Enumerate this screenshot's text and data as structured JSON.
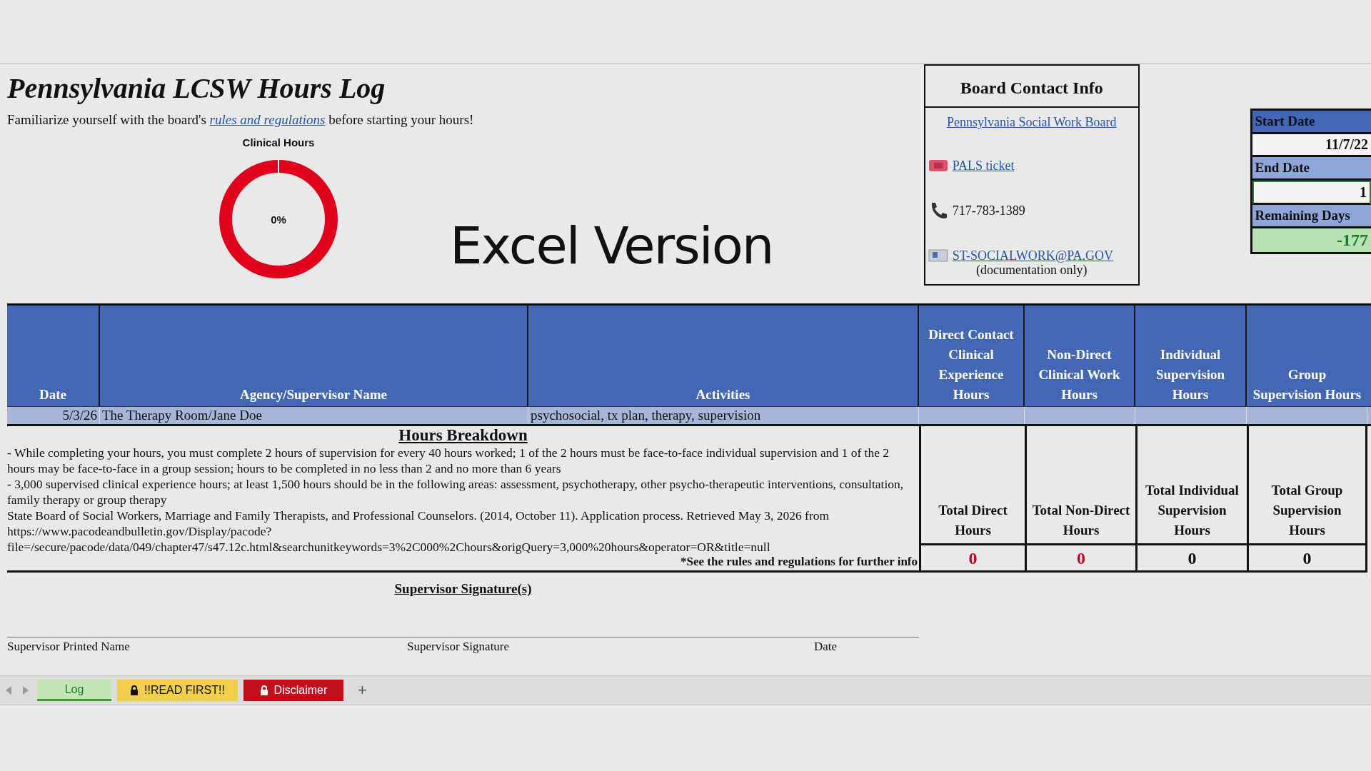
{
  "title": "Pennsylvania LCSW Hours Log",
  "intro": {
    "before": "Familiarize yourself with the board's",
    "link": "rules and regulations",
    "after": "before starting your hours!"
  },
  "clinical_hours": {
    "title": "Clinical Hours",
    "label": "0%",
    "level": 0
  },
  "version_label": "Excel Version",
  "board_contact": {
    "title": "Board Contact Info",
    "board_link": "Pennsylvania Social Work Board",
    "contacts": [
      {
        "kind": "ticket",
        "text": "PALS ticket",
        "link": true
      },
      {
        "kind": "phone",
        "text": "717-783-1389",
        "link": false
      },
      {
        "kind": "mail",
        "text": "ST-SOCIALWORK@PA.GOV",
        "link": true,
        "note": "(documentation only)"
      }
    ]
  },
  "date_cells": [
    {
      "kind": "header",
      "text": "Start Date"
    },
    {
      "kind": "plain",
      "text": "11/7/22"
    },
    {
      "kind": "subheader",
      "text": "End Date"
    },
    {
      "kind": "input",
      "text": "1"
    },
    {
      "kind": "subheader",
      "text": "Remaining Days"
    },
    {
      "kind": "result",
      "text": "-177"
    }
  ],
  "table": {
    "columns": [
      "Date",
      "Agency/Supervisor Name",
      "Activities",
      "Direct Contact Clinical Experience Hours",
      "Non-Direct Clinical Work Hours",
      "Individual Supervision Hours",
      "Group Supervision Hours"
    ],
    "rows": [
      {
        "date": "5/3/26",
        "agency": "The Therapy Room/Jane Doe",
        "activities": "psychosocial, tx plan, therapy, supervision"
      }
    ]
  },
  "hours_breakdown": {
    "title": "Hours Breakdown",
    "paragraphs": [
      "- While completing your hours, you must complete 2 hours of supervision for every 40 hours worked; 1 of the 2 hours must be face-to-face individual supervision and 1 of the 2 hours may be face-to-face in a group session; hours to be completed in no less than 2 and no more than 6 years",
      "- 3,000 supervised clinical experience hours; at least 1,500 hours should be in the following areas: assessment, psychotherapy, other psycho-therapeutic interventions, consultation, family therapy or group therapy",
      "State Board of Social Workers, Marriage and Family Therapists, and Professional Counselors. (2014, October 11). Application process. Retrieved May 3, 2026 from https://www.pacodeandbulletin.gov/Display/pacode?file=/secure/pacode/data/049/chapter47/s47.12c.html&searchunitkeywords=3%2C000%2Chours&origQuery=3,000%20hours&operator=OR&title=null"
    ],
    "footnote": "*See the rules and regulations for further info"
  },
  "totals": [
    {
      "label": "Total Direct Hours",
      "value": "0",
      "color": "#c0001a"
    },
    {
      "label": "Total Non-Direct Hours",
      "value": "0",
      "color": "#c0001a"
    },
    {
      "label": "Total Individual Supervision Hours",
      "value": "0",
      "color": "#111111"
    },
    {
      "label": "Total Group Supervision Hours",
      "value": "0",
      "color": "#111111"
    }
  ],
  "signature": {
    "title": "Supervisor Signature(s)",
    "fields": [
      "Supervisor Printed Name",
      "Supervisor Signature",
      "Date"
    ]
  },
  "sheet_tabs": [
    {
      "label": "Log",
      "selected": true,
      "locked": false,
      "color": "#c4e6b4"
    },
    {
      "label": "!!READ FIRST!!",
      "selected": false,
      "locked": true,
      "color": "#f2cf4a"
    },
    {
      "label": "Disclaimer",
      "selected": false,
      "locked": true,
      "color": "#c0101e"
    }
  ],
  "add_tab": "+"
}
